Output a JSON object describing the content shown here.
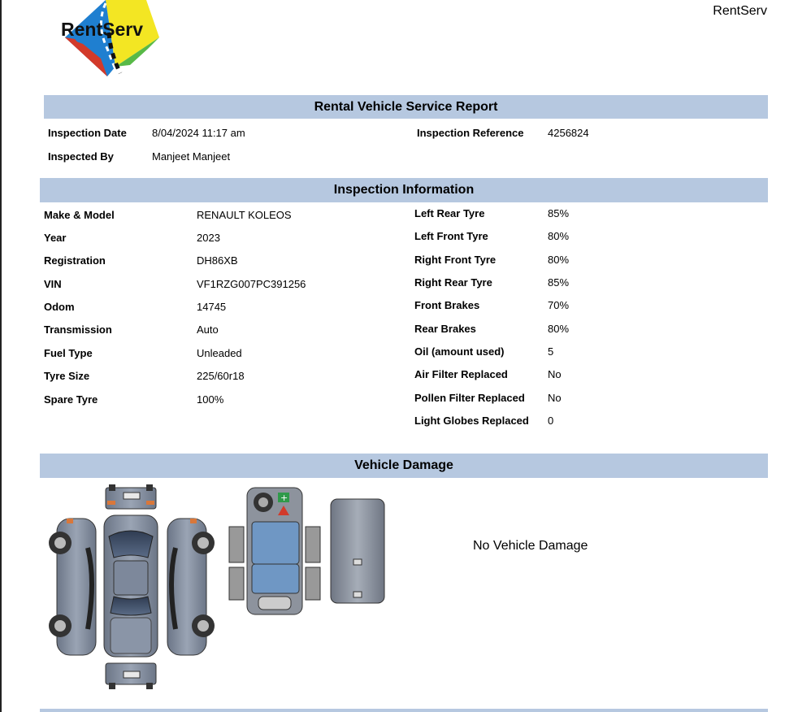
{
  "brand": {
    "name": "RentServ",
    "logo_text": "RentServ"
  },
  "report": {
    "title": "Rental Vehicle Service Report",
    "inspection_date_label": "Inspection Date",
    "inspection_date": "8/04/2024 11:17 am",
    "inspection_reference_label": "Inspection Reference",
    "inspection_reference": "4256824",
    "inspected_by_label": "Inspected By",
    "inspected_by": "Manjeet Manjeet"
  },
  "inspection": {
    "title": "Inspection Information",
    "left": [
      {
        "label": "Make & Model",
        "value": "RENAULT KOLEOS"
      },
      {
        "label": "Year",
        "value": "2023"
      },
      {
        "label": "Registration",
        "value": "DH86XB"
      },
      {
        "label": "VIN",
        "value": "VF1RZG007PC391256"
      },
      {
        "label": "Odom",
        "value": "14745"
      },
      {
        "label": "Transmission",
        "value": "Auto"
      },
      {
        "label": "Fuel Type",
        "value": "Unleaded"
      },
      {
        "label": "Tyre Size",
        "value": "225/60r18"
      },
      {
        "label": "Spare Tyre",
        "value": "100%"
      }
    ],
    "right": [
      {
        "label": "Left Rear Tyre",
        "value": "85%"
      },
      {
        "label": "Left Front Tyre",
        "value": "80%"
      },
      {
        "label": "Right Front Tyre",
        "value": "80%"
      },
      {
        "label": "Right Rear Tyre",
        "value": "85%"
      },
      {
        "label": "Front Brakes",
        "value": "70%"
      },
      {
        "label": "Rear Brakes",
        "value": "80%"
      },
      {
        "label": "Oil (amount used)",
        "value": "5"
      },
      {
        "label": "Air Filter Replaced",
        "value": "No"
      },
      {
        "label": "Pollen Filter Replaced",
        "value": "No"
      },
      {
        "label": "Light Globes Replaced",
        "value": "0"
      }
    ]
  },
  "damage": {
    "title": "Vehicle Damage",
    "status": "No Vehicle Damage"
  }
}
